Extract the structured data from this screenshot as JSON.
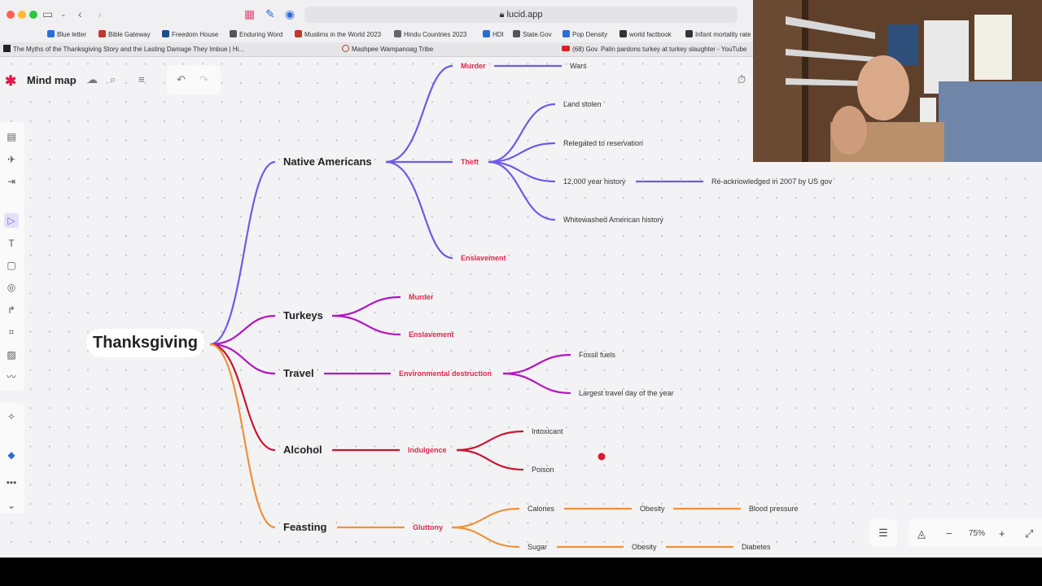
{
  "browser": {
    "url": "lucid.app",
    "bookmarks": [
      {
        "label": "Blue letter",
        "color": "#2a6dd9"
      },
      {
        "label": "Bible Gateway",
        "color": "#c0392b"
      },
      {
        "label": "Freedom House",
        "color": "#1a4d8f"
      },
      {
        "label": "Enduring Word",
        "color": "#555555"
      },
      {
        "label": "Muslims in the World 2023",
        "color": "#c0392b"
      },
      {
        "label": "Hindu Countries 2023",
        "color": "#666666"
      },
      {
        "label": "HDI",
        "color": "#2a6dd9"
      },
      {
        "label": "State.Gov",
        "color": "#555555"
      },
      {
        "label": "Pop Density",
        "color": "#2a6dd9"
      },
      {
        "label": "world factbook",
        "color": "#333333"
      },
      {
        "label": "Infant mortality rate",
        "color": "#333333"
      }
    ],
    "tabs": [
      "The Myths of the Thanksgiving Story and the Lasting Damage They Imbue | Hi...",
      "Mashpee Wampanoag Tribe",
      "(68) Gov. Palin pardons turkey at turkey slaughter - YouTube"
    ]
  },
  "app": {
    "title": "Mind map",
    "zoom": "75%"
  },
  "colors": {
    "native": "#6c5ce7",
    "turkeys": "#b515c4",
    "travel": "#b515c4",
    "alcohol": "#cc1430",
    "feasting": "#f0913a",
    "label_red": "#e0264a"
  },
  "mindmap": {
    "root": "Thanksgiving",
    "native": {
      "label": "Native Americans",
      "murder": "Murder",
      "wars": "Wars",
      "theft": "Theft",
      "land": "Land stolen",
      "reservation": "Relegated to reservation",
      "history": "12,000 year history",
      "reack": "Re-acknowledged in 2007 by US gov",
      "whitewashed": "Whitewashed American history",
      "enslavement": "Enslavement"
    },
    "turkeys": {
      "label": "Turkeys",
      "murder": "Murder",
      "enslavement": "Enslavement"
    },
    "travel": {
      "label": "Travel",
      "env": "Environmental destruction",
      "fossil": "Fossil fuels",
      "largest": "Largest travel day of the year"
    },
    "alcohol": {
      "label": "Alcohol",
      "indulgence": "Indulgence",
      "intoxicant": "Intoxicant",
      "poison": "Poison"
    },
    "feasting": {
      "label": "Feasting",
      "gluttony": "Gluttony",
      "calories": "Calories",
      "obesity1": "Obesity",
      "bp": "Blood pressure",
      "sugar": "Sugar",
      "obesity2": "Obesity",
      "diabetes": "Diabetes"
    }
  }
}
